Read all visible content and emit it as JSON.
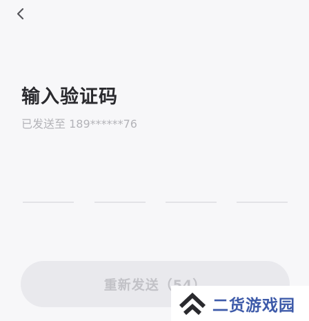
{
  "nav": {
    "back_icon": "chevron-left-icon"
  },
  "title": "输入验证码",
  "subtitle": "已发送至 189******76",
  "code_slots": [
    "",
    "",
    "",
    ""
  ],
  "resend_label": "重新发送（54）",
  "watermark": {
    "text": "二货游戏园",
    "logo_icon": "double-chevron-up-icon"
  },
  "colors": {
    "background": "#f7f7f9",
    "title": "#2a2a2e",
    "muted": "#b3b3b8",
    "button_bg": "#e9e9ed",
    "watermark": "#3d5aa9"
  }
}
